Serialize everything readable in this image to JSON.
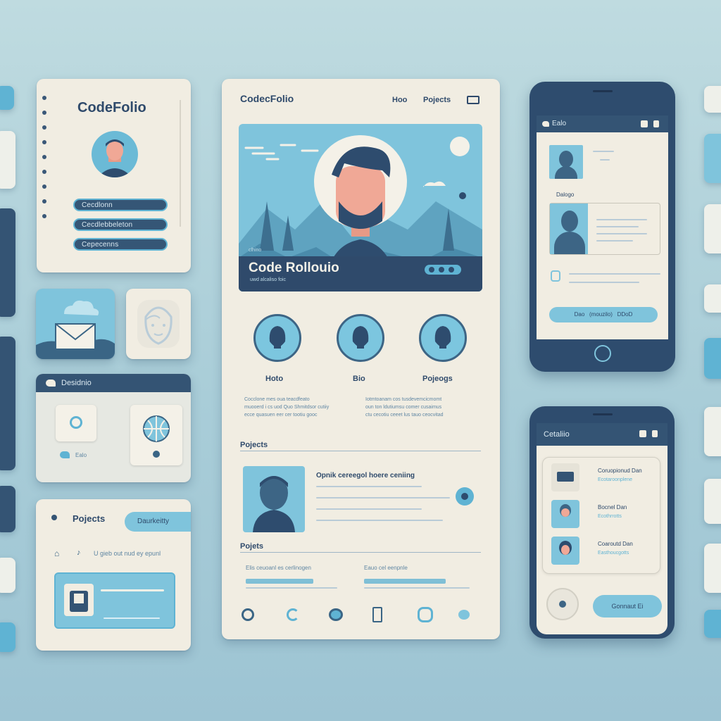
{
  "left_card": {
    "brand": "CodeFolio",
    "menu_items": [
      "Cecdlonn",
      "Cecdlebbeleton",
      "Cepecenns"
    ]
  },
  "designs_card": {
    "title": "Desidnio",
    "caption": "Ealo"
  },
  "projects_card": {
    "title": "Pojects",
    "button": "Daurkeitty",
    "note": "U gieb out nud ey epunl"
  },
  "main": {
    "brand": "CodecFolio",
    "nav": [
      "Hoo",
      "Pojects"
    ],
    "hero_kicker": "clhino",
    "hero_title": "Code Rollouio",
    "hero_sub": "uwd alcaliso foic",
    "features": [
      {
        "label": "Hoto",
        "text": [
          "Cocclone mes oua teacdfeato",
          "muooerd i cs uod Quo Shmitdsor cutiiy",
          "ecce quasuen eer cer tootiu gooc"
        ]
      },
      {
        "label": "Bio",
        "text": [
          "Iotmtoanam cos tusdevemcicmomt",
          "oun ton ldutiumsu comer cusaimus",
          "ctu cecotiu ceeet lus tauo ceocvitad"
        ]
      },
      {
        "label": "Pojeogs",
        "text": []
      }
    ],
    "section1": "Pojects",
    "project_title": "Opnik cereegol hoere ceniing",
    "section2": "Pojets",
    "list_items": [
      "Elis ceuoanl es cerlinogen",
      "Eauo cel eenpnle"
    ]
  },
  "phone1": {
    "title": "Ealo",
    "label": "Dalogo",
    "bottom_button": "Dao   (mouzilo)   DDoD"
  },
  "phone2": {
    "title": "Cetaliio",
    "items": [
      {
        "title": "Coruopionud Dan",
        "sub": "Ecotaroonplene"
      },
      {
        "title": "Bocnel Dan",
        "sub": "Ecothrrotts"
      },
      {
        "title": "Coaroutd Dan",
        "sub": "Easthoucgotts"
      }
    ],
    "button": "Gonnaut Ei"
  }
}
